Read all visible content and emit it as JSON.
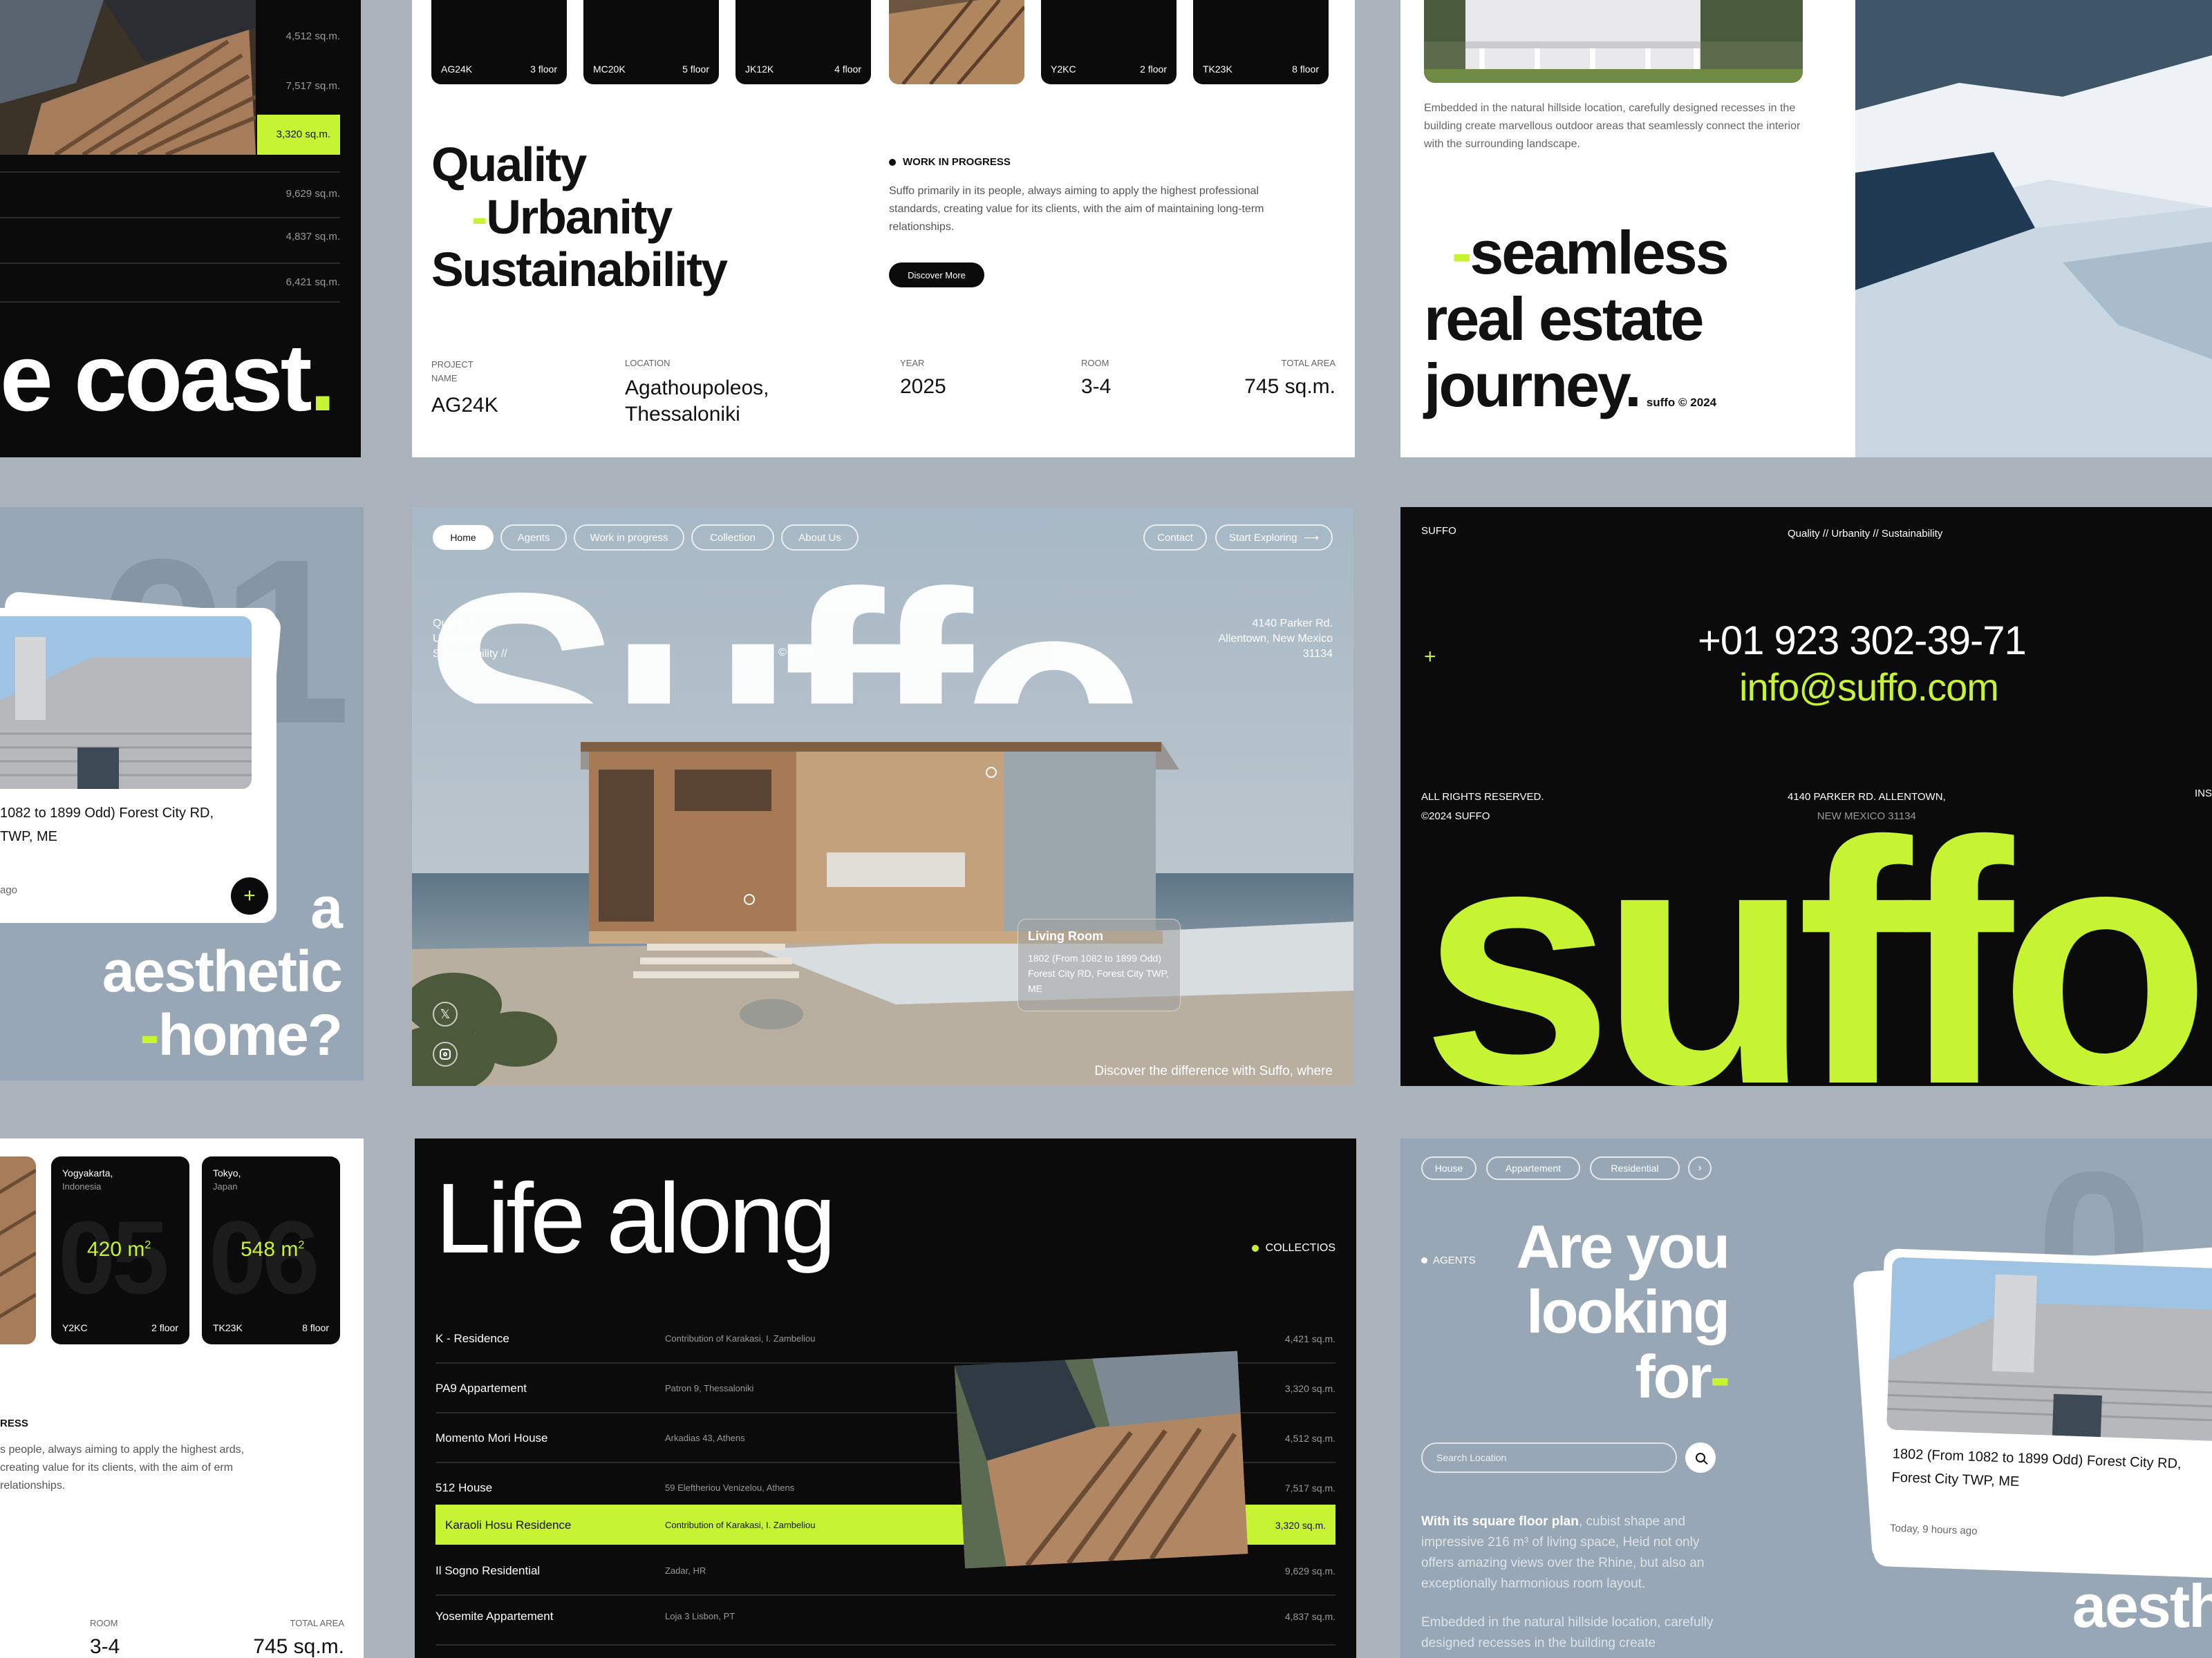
{
  "colors": {
    "accent": "#c6f432",
    "dark": "#0b0b0b",
    "blue_panel": "#97a7b6",
    "background": "#aab2bc"
  },
  "card_a": {
    "areas": [
      "4,512 sq.m.",
      "7,517 sq.m.",
      "3,320 sq.m.",
      "9,629 sq.m.",
      "4,837 sq.m.",
      "6,421 sq.m."
    ],
    "headline": "e coast",
    "period": "."
  },
  "card_b": {
    "tiles": [
      {
        "code": "AG24K",
        "floor": "3 floor"
      },
      {
        "code": "MC20K",
        "floor": "5 floor"
      },
      {
        "code": "JK12K",
        "floor": "4 floor"
      },
      {
        "code": "Y2KC",
        "floor": "2 floor"
      },
      {
        "code": "TK23K",
        "floor": "8 floor"
      }
    ],
    "headline": {
      "line1": "Quality",
      "dash": "-",
      "line2": "Urbanity",
      "line3": "Sustainability"
    },
    "badge": "WORK IN PROGRESS",
    "paragraph": "Suffo primarily in its people, always aiming to apply the highest professional standards, creating value for its clients, with the aim of maintaining long-term relationships.",
    "button": "Discover More",
    "meta": [
      {
        "label": "PROJECT NAME",
        "value": "AG24K"
      },
      {
        "label": "LOCATION",
        "value": "Agathoupoleos, Thessaloniki"
      },
      {
        "label": "YEAR",
        "value": "2025"
      },
      {
        "label": "ROOM",
        "value": "3-4"
      },
      {
        "label": "TOTAL AREA",
        "value": "745 sq.m."
      }
    ]
  },
  "card_c": {
    "paragraph": "Embedded in the natural hillside location, carefully designed recesses in the building create marvellous outdoor areas that seamlessly connect the interior with the surrounding landscape.",
    "dash": "-",
    "line1": "seamless",
    "line2": "real estate",
    "line3": "journey.",
    "copyright": "suffo © 2024"
  },
  "card_d": {
    "bg_number": "01",
    "address": "1082 to 1899 Odd) Forest City RD, TWP, ME",
    "time": "ago",
    "plus": "+",
    "text1": "a",
    "text2": "aesthetic",
    "dash": "-",
    "text3": "home?"
  },
  "hero": {
    "nav": [
      "Home",
      "Agents",
      "Work in progress",
      "Collection",
      "About Us"
    ],
    "contact": "Contact",
    "cta": "Start Exploring",
    "tagline": [
      "Quality //",
      "Urbanity //",
      "Sustainability //"
    ],
    "copyright": "© 2024",
    "address": [
      "4140 Parker Rd.",
      "Allentown, New Mexico",
      "31134"
    ],
    "wordmark": "Suffo",
    "popup_title": "Living Room",
    "popup_text": "1802 (From 1082 to 1899 Odd) Forest City RD, Forest City TWP, ME",
    "bottom_text": "Discover the difference with Suffo, where"
  },
  "card_e": {
    "brand": "SUFFO",
    "tagline": "Quality // Urbanity // Sustainability",
    "plus": "+",
    "phone": "+01 923 302-39-71",
    "email": "info@suffo.com",
    "rights1": "ALL RIGHTS RESERVED.",
    "rights2": "©2024 SUFFO",
    "addr1": "4140 PARKER RD. ALLENTOWN,",
    "addr2": "NEW MEXICO 31134",
    "ins": "INS",
    "wordmark": "suffo"
  },
  "card_f": {
    "tiles": [
      {
        "city": "Yogyakarta,",
        "country": "Indonesia",
        "area": "420 m",
        "code": "Y2KC",
        "floor": "2 floor",
        "num": "05"
      },
      {
        "city": "Tokyo,",
        "country": "Japan",
        "area": "548 m",
        "code": "TK23K",
        "floor": "8 floor",
        "num": "06"
      }
    ],
    "sup": "2",
    "badge": "RESS",
    "paragraph": "s people, always aiming to apply the highest ards, creating value for its clients, with the aim of erm relationships.",
    "room_label": "ROOM",
    "room_value": "3-4",
    "area_label": "TOTAL AREA",
    "area_value": "745 sq.m."
  },
  "card_g": {
    "headline": "Life along",
    "badge": "COLLECTIOS",
    "rows": [
      {
        "name": "K - Residence",
        "address": "Contribution of Karakasi, I. Zambeliou",
        "area": "4,421 sq.m."
      },
      {
        "name": "PA9 Appartement",
        "address": "Patron 9, Thessaloniki",
        "area": "3,320 sq.m."
      },
      {
        "name": "Momento Mori House",
        "address": "Arkadias 43, Athens",
        "area": "4,512 sq.m."
      },
      {
        "name": "512 House",
        "address": "59 Eleftheriou Venizelou, Athens",
        "area": "7,517 sq.m."
      },
      {
        "name": "Karaoli Hosu Residence",
        "address": "Contribution of Karakasi, I. Zambeliou",
        "area": "3,320 sq.m."
      },
      {
        "name": "Il Sogno Residential",
        "address": "Zadar, HR",
        "area": "9,629 sq.m."
      },
      {
        "name": "Yosemite Appartement",
        "address": "Loja 3 Lisbon, PT",
        "area": "4,837 sq.m."
      }
    ]
  },
  "card_h": {
    "filters": [
      "House",
      "Appartement",
      "Residential"
    ],
    "agents": "AGENTS",
    "headline": [
      "Are you",
      "looking",
      "for"
    ],
    "dash": "-",
    "search_placeholder": "Search Location",
    "p1_bold": "With its square floor plan",
    "p1_rest": ", cubist shape and impressive 216 m³ of living space, Heid not only offers amazing views over the Rhine, but also an exceptionally harmonious room layout.",
    "p2": "Embedded in the natural hillside location, carefully designed recesses in the building create",
    "card_address": "1802 (From 1082 to 1899 Odd) Forest City RD, Forest City TWP, ME",
    "card_time": "Today, 9 hours ago",
    "aesth": "aesth",
    "bg_number": "0"
  }
}
